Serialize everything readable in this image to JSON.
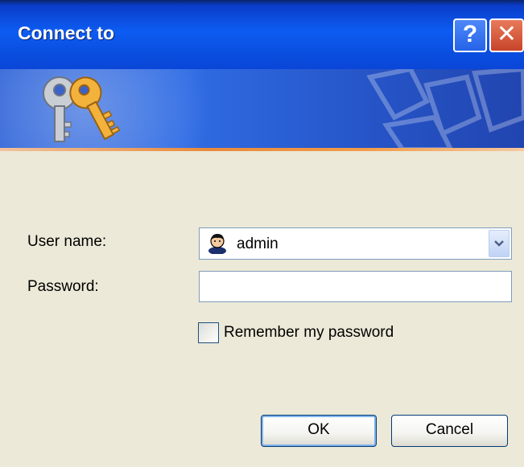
{
  "window": {
    "title": "Connect to",
    "help_button": "?",
    "close_button": "✕"
  },
  "banner": {
    "icon": "keys-icon"
  },
  "form": {
    "username_label": "User name:",
    "username_value": "admin",
    "password_label": "Password:",
    "password_value": "",
    "remember_label": "Remember my password",
    "remember_checked": false
  },
  "buttons": {
    "ok": "OK",
    "cancel": "Cancel"
  },
  "colors": {
    "titlebar": "#0A50E6",
    "dialog_bg": "#ECE9D8",
    "input_border": "#7F9DB9",
    "banner_stripe": "#E88A3B"
  }
}
